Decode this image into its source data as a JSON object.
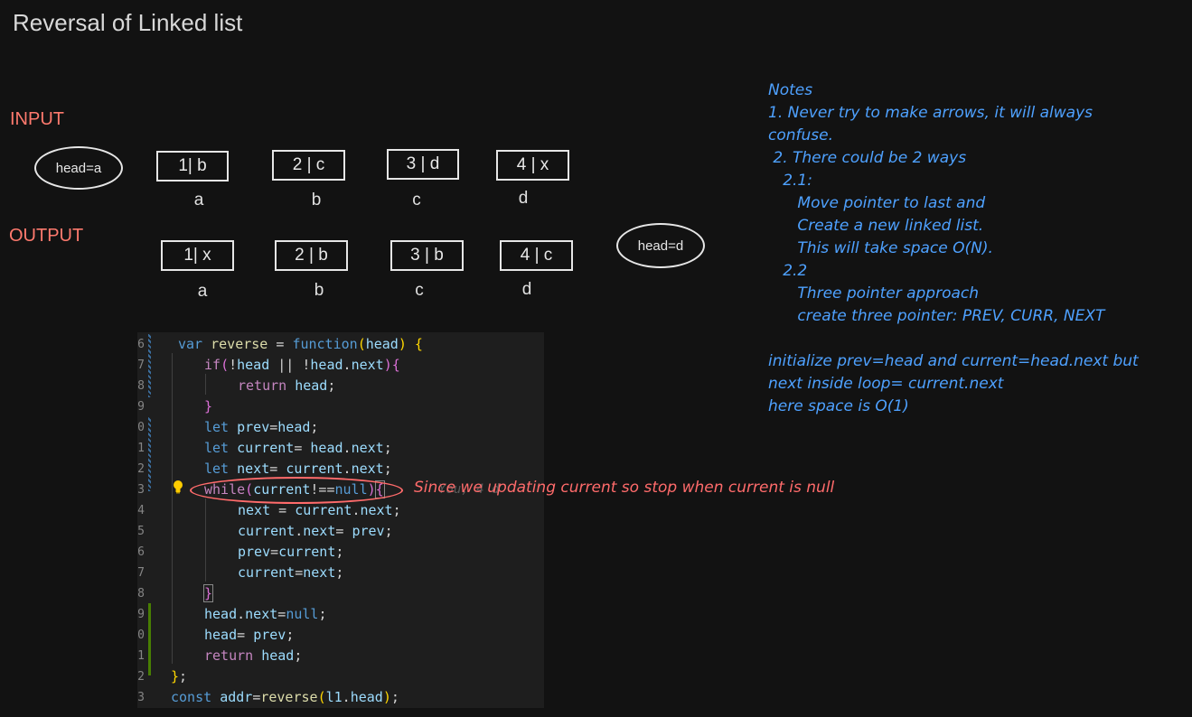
{
  "title": "Reversal of Linked list",
  "input": {
    "label": "INPUT",
    "head": "head=a",
    "nodes": [
      {
        "value": "1| b",
        "addr": "a"
      },
      {
        "value": "2 | c",
        "addr": "b"
      },
      {
        "value": "3 | d",
        "addr": "c"
      },
      {
        "value": "4 | x",
        "addr": "d"
      }
    ]
  },
  "output": {
    "label": "OUTPUT",
    "head": "head=d",
    "nodes": [
      {
        "value": "1| x",
        "addr": "a"
      },
      {
        "value": "2 | b",
        "addr": "b"
      },
      {
        "value": "3 | b",
        "addr": "c"
      },
      {
        "value": "4 | c",
        "addr": "d"
      }
    ]
  },
  "notes": [
    "Notes",
    "1. Never try to make arrows, it will always",
    "confuse.",
    " 2. There could be 2 ways",
    "   2.1:",
    "      Move pointer to last and",
    "      Create a new linked list.",
    "      This will take space O(N).",
    "   2.2",
    "      Three pointer approach",
    "      create three pointer: PREV, CURR, NEXT",
    "",
    "initialize prev=head and current=head.next but",
    "next inside loop= current.next",
    "here space is O(1)"
  ],
  "code": {
    "gutter": [
      "6",
      "7",
      "8",
      "9",
      "0",
      "1",
      "2",
      "3",
      "4",
      "5",
      "6",
      "7",
      "8",
      "9",
      "0",
      "1",
      "2",
      "3"
    ],
    "ghost_hint": "You, 4 d"
  },
  "annotation": "Since we updating current so stop when current is null",
  "colors": {
    "background": "#121212",
    "section_label": "#ff7a6e",
    "notes": "#4ea1ff",
    "annotation": "#ff6b6b",
    "editor_bg": "#1e1e1e"
  }
}
